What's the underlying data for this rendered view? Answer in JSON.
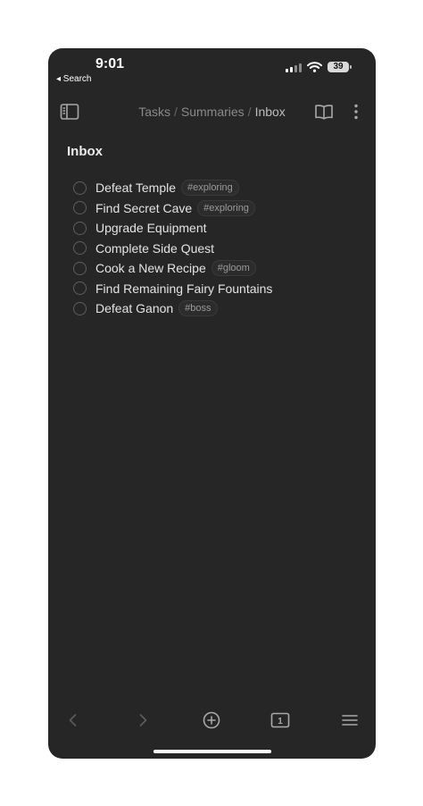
{
  "status_bar": {
    "time": "9:01",
    "back_label": "◂ Search",
    "battery": "39"
  },
  "header": {
    "breadcrumb": [
      "Tasks",
      "Summaries",
      "Inbox"
    ],
    "icons": [
      "sidebar-toggle-icon",
      "book-icon",
      "more-vertical-icon"
    ]
  },
  "page": {
    "title": "Inbox",
    "tasks": [
      {
        "label": "Defeat Temple",
        "tag": "#exploring"
      },
      {
        "label": "Find Secret Cave",
        "tag": "#exploring"
      },
      {
        "label": "Upgrade Equipment",
        "tag": ""
      },
      {
        "label": "Complete Side Quest",
        "tag": ""
      },
      {
        "label": "Cook a New Recipe",
        "tag": "#gloom"
      },
      {
        "label": "Find Remaining Fairy Fountains",
        "tag": ""
      },
      {
        "label": "Defeat Ganon",
        "tag": "#boss"
      }
    ]
  },
  "bottom_bar": {
    "tab_count": "1",
    "icons": [
      "back-arrow-icon",
      "forward-arrow-icon",
      "add-circle-icon",
      "tabs-icon",
      "menu-icon"
    ]
  },
  "colors": {
    "background": "#262626",
    "text": "#e3e3e3",
    "muted": "#8a8a8a"
  }
}
